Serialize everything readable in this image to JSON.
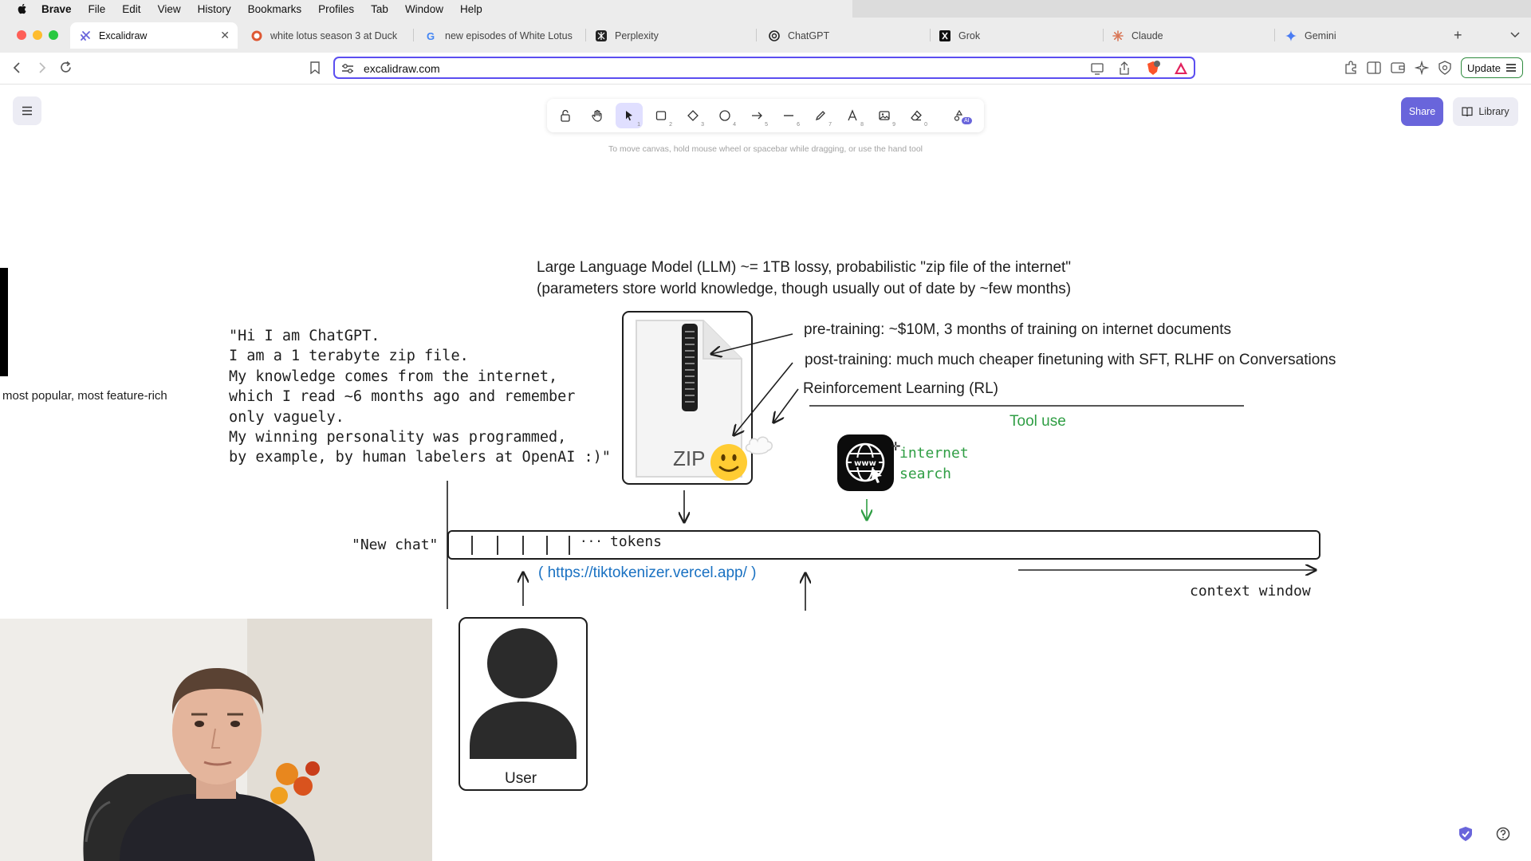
{
  "menubar": {
    "app_name": "Brave",
    "items": [
      "File",
      "Edit",
      "View",
      "History",
      "Bookmarks",
      "Profiles",
      "Tab",
      "Window",
      "Help"
    ]
  },
  "tabs": [
    {
      "title": "Excalidraw",
      "active": true
    },
    {
      "title": "white lotus season 3 at Duck",
      "active": false
    },
    {
      "title": "new episodes of White Lotus",
      "active": false
    },
    {
      "title": "Perplexity",
      "active": false
    },
    {
      "title": "ChatGPT",
      "active": false
    },
    {
      "title": "Grok",
      "active": false
    },
    {
      "title": "Claude",
      "active": false
    },
    {
      "title": "Gemini",
      "active": false
    }
  ],
  "toolbar": {
    "url": "excalidraw.com",
    "update_label": "Update"
  },
  "excalidraw": {
    "hint": "To move canvas, hold mouse wheel or spacebar while dragging, or use the hand tool",
    "share_label": "Share",
    "library_label": "Library",
    "tool_numbers": [
      "1",
      "2",
      "3",
      "4",
      "5",
      "6",
      "7",
      "8",
      "9",
      "0"
    ],
    "ai_badge": "AI",
    "accent_color": "#6965db"
  },
  "canvas": {
    "title_line1": "Large Language Model (LLM) ~= 1TB lossy, probabilistic \"zip file of the internet\"",
    "title_line2": "(parameters store world knowledge, though usually out of date by ~few months)",
    "chatgpt_quote": "\"Hi I am ChatGPT.\nI am a 1 terabyte zip file.\nMy knowledge comes from the internet,\nwhich I read ~6 months ago and remember\nonly vaguely.\nMy winning personality was programmed,\nby example, by human labelers at OpenAI :)\"",
    "side_text": "most popular, most feature-rich",
    "pretraining": "pre-training: ~$10M, 3 months of training on internet documents",
    "posttraining": "post-training: much much cheaper finetuning with SFT, RLHF on Conversations",
    "rl": "Reinforcement Learning (RL)",
    "tool_use": "Tool use",
    "internet_search_line1": "internet",
    "internet_search_line2": "search",
    "zip_label": "ZIP",
    "new_chat": "\"New chat\"",
    "tokens_ellipsis": "...",
    "tokens": "tokens",
    "tiktokenizer": "( https://tiktokenizer.vercel.app/ )",
    "context_window": "context window",
    "user_label": "User",
    "green_color": "#2f9e44",
    "link_color": "#1971c2"
  }
}
